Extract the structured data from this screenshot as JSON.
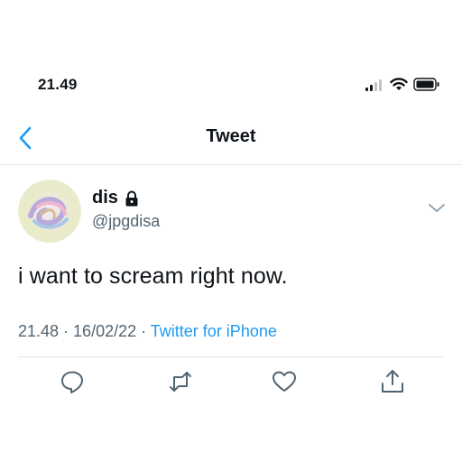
{
  "status_bar": {
    "time": "21.49"
  },
  "nav": {
    "title": "Tweet"
  },
  "tweet": {
    "display_name": "dis",
    "handle": "@jpgdisa",
    "text": "i want to scream right now.",
    "time": "21.48",
    "separator": " · ",
    "date": "16/02/22",
    "source": "Twitter for iPhone"
  },
  "icons": {
    "back": "chevron-left-icon",
    "lock": "lock-icon",
    "more": "chevron-down-icon",
    "reply": "reply-icon",
    "retweet": "retweet-icon",
    "like": "heart-icon",
    "share": "share-icon"
  },
  "colors": {
    "accent": "#1d9bf0",
    "text": "#0f1419",
    "secondary": "#536471",
    "icon_gray": "#536471"
  }
}
